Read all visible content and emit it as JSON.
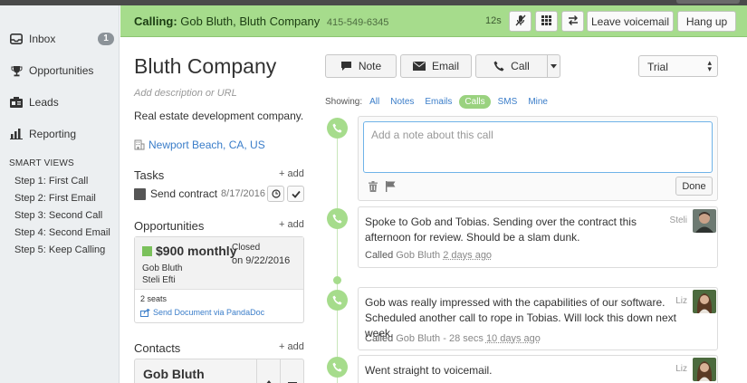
{
  "sidebar": {
    "items": [
      {
        "label": "Inbox",
        "icon": "inbox-icon",
        "badge": "1"
      },
      {
        "label": "Opportunities",
        "icon": "trophy-icon"
      },
      {
        "label": "Leads",
        "icon": "leads-icon"
      },
      {
        "label": "Reporting",
        "icon": "reporting-icon"
      }
    ],
    "smart_views_title": "SMART VIEWS",
    "smart_views": [
      "Step 1: First Call",
      "Step 2: First Email",
      "Step 3: Second Call",
      "Step 4: Second Email",
      "Step 5: Keep Calling"
    ]
  },
  "callbar": {
    "calling_label": "Calling:",
    "calling_name": "Gob Bluth, Bluth Company",
    "phone": "415-549-6345",
    "timer": "12s",
    "leave_voicemail": "Leave voicemail",
    "hang_up": "Hang up"
  },
  "lead": {
    "company": "Bluth Company",
    "description_placeholder": "Add description or URL",
    "description": "Real estate development company.",
    "address": "Newport Beach, CA, US",
    "tasks_title": "Tasks",
    "add_label": "+ add",
    "task": {
      "label": "Send contract",
      "date": "8/17/2016"
    },
    "opportunities_title": "Opportunities",
    "opportunity": {
      "value": "$900 monthly",
      "status_line1": "Closed",
      "status_line2": "on 9/22/2016",
      "contact": "Gob Bluth",
      "user": "Steli Efti",
      "seats": "2 seats",
      "pandadoc": "Send Document via PandaDoc"
    },
    "contacts_title": "Contacts",
    "contact_name": "Gob Bluth"
  },
  "actions": {
    "note": "Note",
    "email": "Email",
    "call": "Call",
    "status_select": "Trial"
  },
  "filters": {
    "showing_label": "Showing:",
    "items": [
      "All",
      "Notes",
      "Emails",
      "Calls",
      "SMS",
      "Mine"
    ],
    "active": "Calls"
  },
  "note_box": {
    "placeholder": "Add a note about this call",
    "done": "Done"
  },
  "activities": [
    {
      "text": "Spoke to Gob and Tobias. Sending over the contract this afternoon for review. Should be a slam dunk.",
      "user": "Steli",
      "meta_prefix": "Called",
      "meta_contact": "Gob Bluth",
      "meta_duration": "",
      "meta_ago": "2 days ago"
    },
    {
      "text": "Gob was really impressed with the capabilities of our software. Scheduled another call to rope in Tobias. Will lock this down next week.",
      "user": "Liz",
      "meta_prefix": "Called",
      "meta_contact": "Gob Bluth",
      "meta_duration": "- 28 secs",
      "meta_ago": "10 days ago"
    },
    {
      "text": "Went straight to voicemail.",
      "user": "Liz"
    }
  ],
  "colors": {
    "call_green": "#a6dc8c",
    "link_blue": "#3a7dc9",
    "sidebar_bg": "#eceff1"
  }
}
